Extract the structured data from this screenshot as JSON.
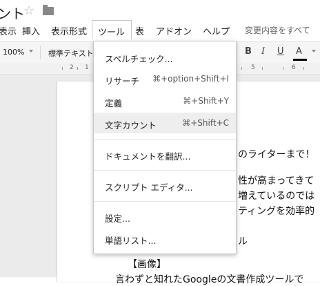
{
  "document": {
    "title": "ント"
  },
  "menu": {
    "items": [
      "表示",
      "挿入",
      "表示形式",
      "ツール",
      "表",
      "アドオン",
      "ヘルプ"
    ],
    "autosave": "変更内容をすべて"
  },
  "toolbar": {
    "zoom": "100%",
    "style": "標準テキスト",
    "bold": "B",
    "italic": "I",
    "underline": "U",
    "text_color": "A"
  },
  "ruler": {
    "numbers": [
      "2",
      "1",
      "5",
      "6"
    ]
  },
  "tools_menu": {
    "items": [
      {
        "label": "スペルチェック...",
        "shortcut": ""
      },
      {
        "label": "リサーチ",
        "shortcut": "⌘+option+Shift+I"
      },
      {
        "label": "定義",
        "shortcut": "⌘+Shift+Y"
      },
      {
        "label": "文字カウント",
        "shortcut": "⌘+Shift+C"
      },
      {
        "label": "ドキュメントを翻訳...",
        "shortcut": ""
      },
      {
        "label": "スクリプト エディタ...",
        "shortcut": ""
      },
      {
        "label": "設定...",
        "shortcut": ""
      },
      {
        "label": "単語リスト...",
        "shortcut": ""
      }
    ]
  },
  "page": {
    "lines": [
      "のライターまで！",
      "性が高まってきて",
      "増えているのでは",
      "ティングを効率的",
      "ル",
      "【画像】",
      "言わずと知れたGoogleの文書作成ツールで"
    ]
  },
  "colors": {
    "highlight": "#eeeeee",
    "menu_border": "#c6c6c6"
  }
}
